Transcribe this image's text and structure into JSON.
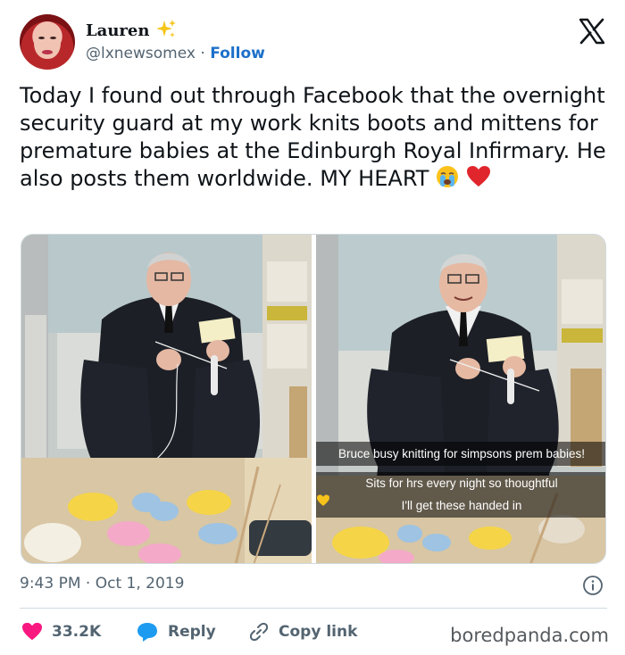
{
  "author": {
    "name": "Lauren",
    "name_icon": "sparkle-icon",
    "handle": "@lxnewsomex",
    "separator": "·",
    "follow_label": "Follow"
  },
  "platform_icon": "x-logo-icon",
  "tweet": {
    "text": "Today I found out through Facebook that the overnight security guard at my work knits boots and mittens for premature babies at the Edinburgh Royal Infirmary. He also posts them worldwide. MY HEART",
    "emojis": [
      "crying-face-emoji",
      "red-heart-emoji"
    ]
  },
  "media": {
    "count": 2,
    "captions": [
      "Bruce busy knitting for simpsons prem babies!",
      "Sits for hrs every night so thoughtful",
      "I'll get these handed in"
    ],
    "caption_emoji": "yellow-heart-emoji"
  },
  "meta": {
    "time": "9:43 PM",
    "separator": "·",
    "date": "Oct 1, 2019",
    "info_icon": "info-icon"
  },
  "actions": {
    "like_count": "33.2K",
    "reply_label": "Reply",
    "copy_label": "Copy link"
  },
  "watermark": "boredpanda.com",
  "colors": {
    "like": "#f91880",
    "reply": "#1d9bf0",
    "link": "#1d70c9",
    "text": "#0f1419",
    "muted": "#536471"
  }
}
